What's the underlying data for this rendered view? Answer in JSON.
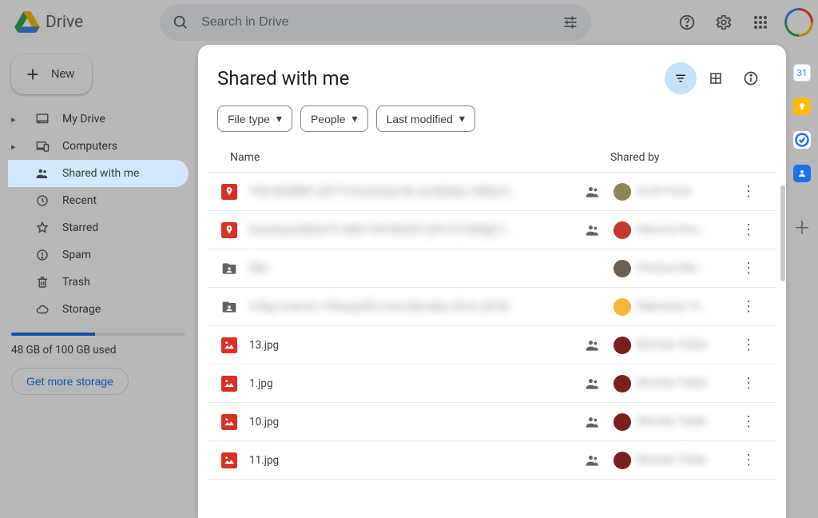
{
  "brand": "Drive",
  "search_placeholder": "Search in Drive",
  "new_button": "New",
  "nav": {
    "my_drive": "My Drive",
    "computers": "Computers",
    "shared": "Shared with me",
    "recent": "Recent",
    "starred": "Starred",
    "spam": "Spam",
    "trash": "Trash",
    "storage": "Storage"
  },
  "storage": {
    "used_text": "48 GB of 100 GB used",
    "percent": 48,
    "cta": "Get more storage"
  },
  "main": {
    "title": "Shared with me",
    "filters": {
      "file_type": "File type",
      "people": "People",
      "last_modified": "Last modified"
    },
    "columns": {
      "name": "Name",
      "shared_by": "Shared by"
    }
  },
  "rows": [
    {
      "icon": "map-pin",
      "name": "THE MUMMY (2017) Download 4K via BluRay 1080p D...",
      "name_blur": true,
      "people_icon": true,
      "avatar_color": "#8a8553",
      "shared_by": "Scott Crane"
    },
    {
      "icon": "map-pin",
      "name": "Download BEAUTY AND THE BEAST (2017) [1080p] T...",
      "name_blur": true,
      "people_icon": true,
      "avatar_color": "#c0392b",
      "shared_by": "Maurycy Ros..."
    },
    {
      "icon": "shared-folder",
      "name": "fdfs",
      "name_blur": true,
      "people_icon": false,
      "avatar_color": "#6b6055",
      "shared_by": "Precious Bar..."
    },
    {
      "icon": "shared-folder",
      "name": "V-Ray 3.60.03 + PhoenixFD 3.04 (3ds Max 2013_2018)",
      "name_blur": true,
      "people_icon": false,
      "avatar_color": "#f6b73c",
      "shared_by": "Nightwing 75..."
    },
    {
      "icon": "image",
      "name": "13.jpg",
      "name_blur": false,
      "people_icon": true,
      "avatar_color": "#7a1f1f",
      "shared_by": "Monster Trailer"
    },
    {
      "icon": "image",
      "name": "1.jpg",
      "name_blur": false,
      "people_icon": true,
      "avatar_color": "#7a1f1f",
      "shared_by": "Monster Trailer"
    },
    {
      "icon": "image",
      "name": "10.jpg",
      "name_blur": false,
      "people_icon": true,
      "avatar_color": "#7a1f1f",
      "shared_by": "Monster Trailer"
    },
    {
      "icon": "image",
      "name": "11.jpg",
      "name_blur": false,
      "people_icon": true,
      "avatar_color": "#7a1f1f",
      "shared_by": "Monster Trailer"
    }
  ]
}
